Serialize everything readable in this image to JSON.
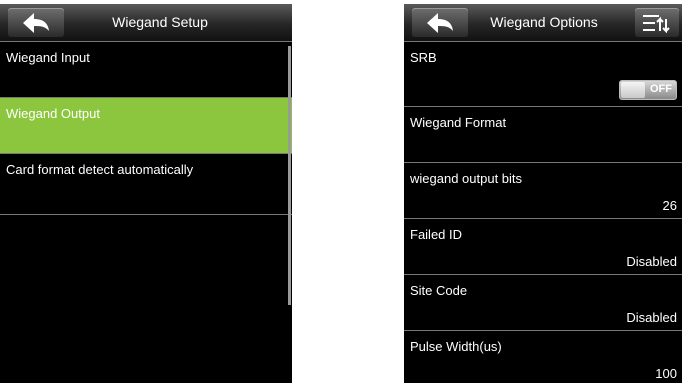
{
  "left_screen": {
    "title": "Wiegand Setup",
    "items": [
      {
        "label": "Wiegand Input"
      },
      {
        "label": "Wiegand Output"
      },
      {
        "label": "Card format detect automatically"
      }
    ],
    "selected_index": 1,
    "icons": {
      "back": "back-arrow-icon"
    }
  },
  "right_screen": {
    "title": "Wiegand Options",
    "icons": {
      "back": "back-arrow-icon",
      "menu": "sort-menu-icon"
    },
    "items": [
      {
        "label": "SRB",
        "toggle": "OFF",
        "toggle_on": false
      },
      {
        "label": "Wiegand Format",
        "value": ""
      },
      {
        "label": "wiegand output bits",
        "value": "26"
      },
      {
        "label": "Failed ID",
        "value": "Disabled"
      },
      {
        "label": "Site Code",
        "value": "Disabled"
      },
      {
        "label": "Pulse Width(us)",
        "value": "100"
      }
    ]
  },
  "colors": {
    "selected": "#8cc63f",
    "background": "#000000",
    "text": "#ffffff"
  }
}
